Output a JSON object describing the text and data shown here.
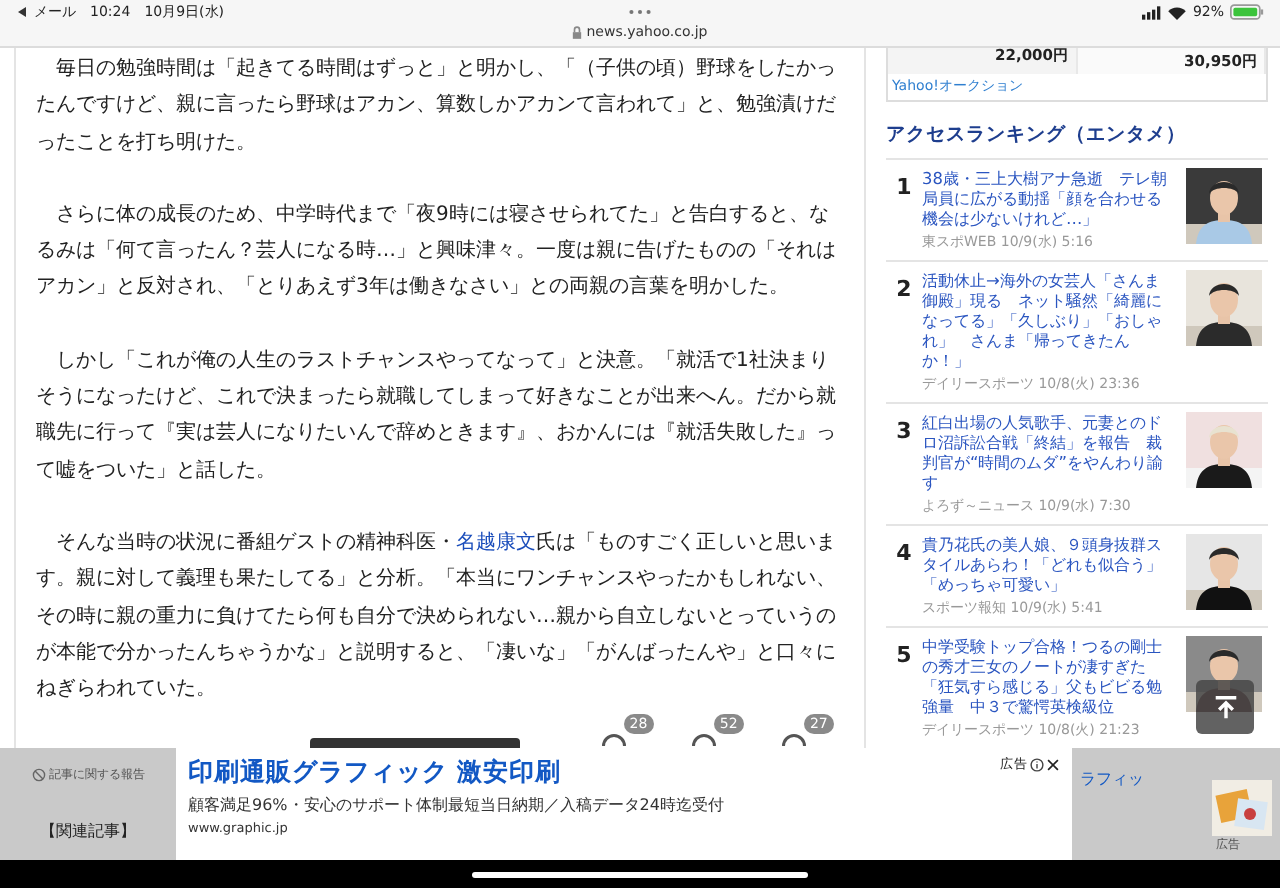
{
  "status_bar": {
    "back_label": "メール",
    "time": "10:24",
    "date": "10月9日(水)",
    "battery": "92%"
  },
  "url_bar": {
    "url": "news.yahoo.co.jp"
  },
  "article": {
    "paragraphs": [
      {
        "parts": [
          {
            "text": "毎日の勉強時間は「起きてる時間はずっと」と明かし、「（子供の頃）野球をしたかったんですけど、親に言ったら野球はアカン、算数しかアカンて言われて」と、勉強漬けだったことを打ち明けた。",
            "link": false
          }
        ]
      },
      {
        "parts": [
          {
            "text": "さらに体の成長のため、中学時代まで「夜9時には寝させられてた」と告白すると、なるみは「何て言ったん？芸人になる時…」と興味津々。一度は親に告げたものの「それはアカン」と反対され、「とりあえず3年は働きなさい」との両親の言葉を明かした。",
            "link": false
          }
        ]
      },
      {
        "parts": [
          {
            "text": "しかし「これが俺の人生のラストチャンスやってなって」と決意。「就活で1社決まりそうになったけど、これで決まったら就職してしまって好きなことが出来へん。だから就職先に行って『実は芸人になりたいんで辞めときます』、おかんには『就活失敗した』って嘘をついた」と話した。",
            "link": false
          }
        ]
      },
      {
        "parts": [
          {
            "text": "そんな当時の状況に番組ゲストの精神科医・",
            "link": false
          },
          {
            "text": "名越康文",
            "link": true
          },
          {
            "text": "氏は「ものすごく正しいと思います。親に対して義理も果たしてる」と分析。「本当にワンチャンスやったかもしれない、その時に親の重力に負けてたら何も自分で決められない…親から自立しないとっていうのが本能で分かったんちゃうかな」と説明すると、「凄いな」「がんばったんや」と口々にねぎらわれていた。",
            "link": false
          }
        ]
      }
    ],
    "reactions": [
      {
        "count": "28"
      },
      {
        "count": "52"
      },
      {
        "count": "27"
      }
    ]
  },
  "sidebar": {
    "auction": {
      "prices": [
        "22,000円",
        "30,950円"
      ],
      "link": "Yahoo!オークション"
    },
    "ranking": {
      "title": "アクセスランキング（エンタメ）",
      "items": [
        {
          "rank": "1",
          "title": "38歳・三上大樹アナ急逝　テレ朝局員に広がる動揺「顔を合わせる機会は少ないけれど…」",
          "meta": "東スポWEB 10/9(水) 5:16"
        },
        {
          "rank": "2",
          "title": "活動休止→海外の女芸人「さんま御殿」現る　ネット騒然「綺麗になってる」「久しぶり」「おしゃれ」　さんま「帰ってきたんか！」",
          "meta": "デイリースポーツ 10/8(火) 23:36"
        },
        {
          "rank": "3",
          "title": "紅白出場の人気歌手、元妻とのドロ沼訴訟合戦「終結」を報告　裁判官が“時間のムダ”をやんわり諭す",
          "meta": "よろず～ニュース 10/9(水) 7:30"
        },
        {
          "rank": "4",
          "title": "貴乃花氏の美人娘、９頭身抜群スタイルあらわ！「どれも似合う」「めっちゃ可愛い」",
          "meta": "スポーツ報知 10/9(水) 5:41"
        },
        {
          "rank": "5",
          "title": "中学受験トップ合格！つるの剛士の秀才三女のノートが凄すぎた「狂気すら感じる」父もビビる勉強量　中３で驚愕英検級位",
          "meta": "デイリースポーツ 10/8(火) 21:23"
        }
      ]
    }
  },
  "ad_bar": {
    "report_link": "記事に関する報告",
    "related": "【関連記事】",
    "ad": {
      "label": "広告",
      "title": "印刷通販グラフィック 激安印刷",
      "description": "顧客満足96%・安心のサポート体制最短当日納期／入稿データ24時迄受付",
      "url": "www.graphic.jp"
    },
    "side_ad": {
      "text": "ラフィッ",
      "label": "広告"
    }
  }
}
